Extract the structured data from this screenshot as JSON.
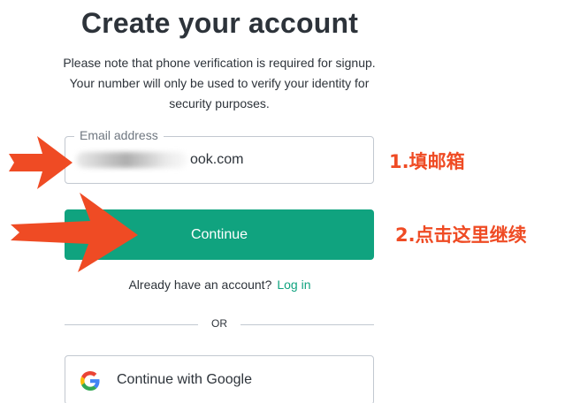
{
  "signup": {
    "title": "Create your account",
    "subtitle": "Please note that phone verification is required for signup. Your number will only be used to verify your identity for security purposes.",
    "email_label": "Email address",
    "email_value": "ook.com",
    "continue_label": "Continue",
    "login_prompt": "Already have an account?",
    "login_link": "Log in",
    "or_text": "OR",
    "google_label": "Continue with Google"
  },
  "annotations": {
    "step1": "1.填邮箱",
    "step2": "2.点击这里继续"
  },
  "colors": {
    "accent": "#10a37f",
    "annotation": "#ef4b24",
    "text": "#2d333a",
    "border": "#c2c8d0"
  },
  "icons": {
    "google": "google-logo-icon",
    "arrow": "red-arrow-icon"
  }
}
